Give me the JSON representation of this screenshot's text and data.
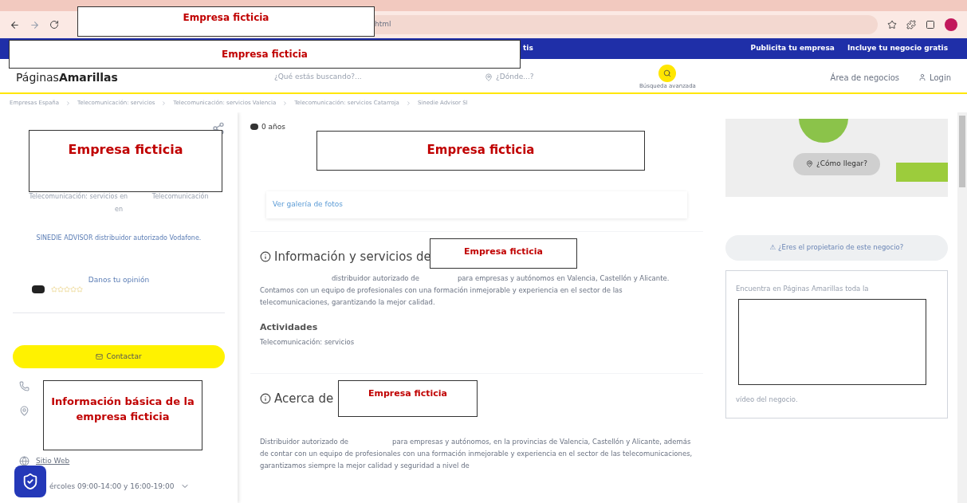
{
  "browser": {
    "url_fragment": "html",
    "overlay": "Empresa ficticia"
  },
  "topbar": {
    "fragment": "tis",
    "links": [
      "Publicita tu empresa",
      "Incluye tu negocio gratis"
    ],
    "overlay": "Empresa ficticia"
  },
  "header": {
    "logo": "Páginas**Amarillas**",
    "search_placeholder": "¿Qué estás buscando?...",
    "where_placeholder": "¿Dónde...?",
    "advanced": "Búsqueda avanzada",
    "business_area": "Área de negocios",
    "login": "Login"
  },
  "breadcrumb": [
    "Empresas España",
    "Telecomunicación: servicios",
    "Telecomunicación: servicios Valencia",
    "Telecomunicación: servicios Catarroja",
    "Sinedie Advisor Sl"
  ],
  "sidebar": {
    "overlay": "Empresa ficticia",
    "category_lines": [
      "Telecomunicación: servicios en",
      "Telecomunicación",
      "en"
    ],
    "tagline": "SINEDIE ADVISOR distribuidor autorizado Vodafone.",
    "review_link": "Danos tu opinión",
    "stars": 0,
    "contact": "Contactar",
    "info_overlay": "Información básica de la empresa ficticia",
    "website": "Sitio Web",
    "hours": "ércoles 09:00-14:00 y 16:00-19:00"
  },
  "main": {
    "years": "0 años",
    "photos_overlay": "Empresa ficticia",
    "gallery_link": "Ver galería de fotos",
    "info": {
      "title": "Información y servicios de",
      "overlay": "Empresa ficticia",
      "text_start": "distribuidor autorizado de",
      "text_rest": "para empresas y autónomos en Valencia, Castellón y Alicante. Contamos con un equipo de profesionales con una formación inmejorable y experiencia en el sector de las telecomunicaciones, garantizando la mejor calidad."
    },
    "activities": {
      "title": "Actividades",
      "text": "Telecomunicación: servicios"
    },
    "about": {
      "title": "Acerca de",
      "overlay": "Empresa ficticia",
      "text_start": "Distribuidor autorizado de",
      "text_rest": "para empresas y autónomos, en la provincias de Valencia, Castellón y Alicante, además de contar con un equipo de profesionales con una formación inmejorable y experiencia en el sector de las telecomunicaciones, garantizamos siempre la mejor calidad y seguridad a nivel de"
    }
  },
  "aside": {
    "directions": "¿Cómo llegar?",
    "owner": "⚠ ¿Eres el propietario de este negocio?",
    "promo_start": "Encuentra en Páginas Amarillas toda la",
    "promo_end": "vídeo del negocio."
  }
}
